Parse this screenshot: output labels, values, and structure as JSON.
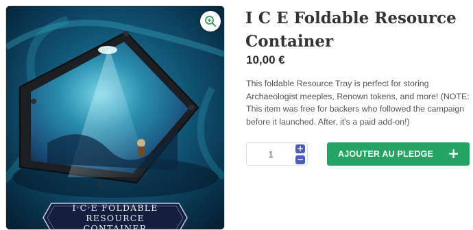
{
  "product": {
    "title": "I C E Foldable Resource Container",
    "price": "10,00 €",
    "description": "This foldable Resource Tray is perfect for storing Archaeologist meeples, Renown tokens, and more! (NOTE: This item was free for backers who followed the campaign before it launched. After, it's a paid add-on!)"
  },
  "gallery": {
    "banner_line1": "I·C·E Foldable Resource",
    "banner_line2": "Container",
    "zoom_icon": "zoom-in-icon"
  },
  "cart": {
    "quantity": "1",
    "increment_symbol": "+",
    "decrement_symbol": "−",
    "add_button_label": "AJOUTER AU PLEDGE",
    "add_button_icon": "+"
  },
  "colors": {
    "add_button": "#23a462",
    "stepper": "#4c5cc0",
    "title": "#333333",
    "zoom_icon": "#2e9a5c"
  }
}
